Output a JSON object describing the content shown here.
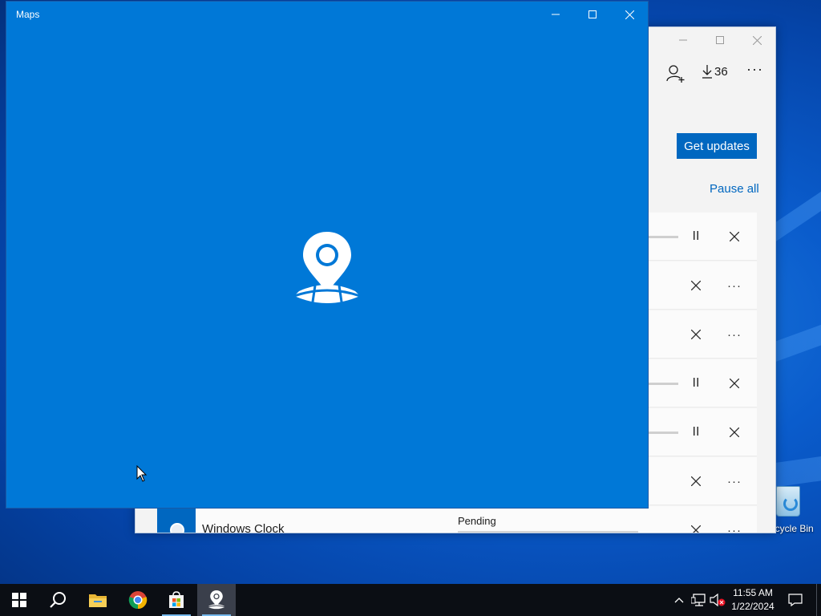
{
  "desktop": {
    "recycle_bin_label": "Recycle Bin"
  },
  "store_window": {
    "minimize_icon": "minimize-icon",
    "maximize_icon": "maximize-icon",
    "close_icon": "close-icon",
    "downloads_count": "36",
    "get_updates_label": "Get updates",
    "pause_all_label": "Pause all",
    "rows": [
      {
        "controls": [
          "pause",
          "cancel"
        ],
        "has_progress": true
      },
      {
        "controls": [
          "cancel",
          "more"
        ],
        "has_progress": false
      },
      {
        "controls": [
          "cancel",
          "more"
        ],
        "has_progress": false
      },
      {
        "controls": [
          "pause",
          "cancel"
        ],
        "has_progress": true
      },
      {
        "controls": [
          "pause",
          "cancel"
        ],
        "has_progress": true
      },
      {
        "controls": [
          "cancel",
          "more"
        ],
        "has_progress": false
      }
    ],
    "clock_row": {
      "app_name": "Windows Clock",
      "status": "Pending"
    }
  },
  "maps_window": {
    "title": "Maps",
    "background_color": "#0078d7"
  },
  "taskbar": {
    "pinned": [
      "start",
      "search",
      "file-explorer",
      "chrome",
      "microsoft-store",
      "maps"
    ],
    "clock_time": "11:55 AM",
    "clock_date": "1/22/2024"
  }
}
